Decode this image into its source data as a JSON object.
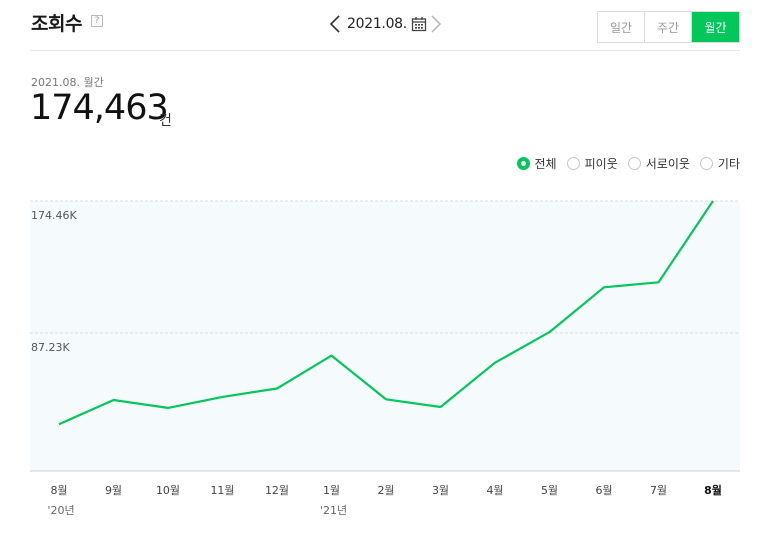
{
  "header": {
    "title": "조회수",
    "help_label": "?",
    "date_label": "2021.08.",
    "tabs": [
      {
        "label": "일간",
        "active": false
      },
      {
        "label": "주간",
        "active": false
      },
      {
        "label": "월간",
        "active": true
      }
    ]
  },
  "summary": {
    "date": "2021.08. 월간",
    "value": "174,463",
    "unit": "건"
  },
  "legend": {
    "items": [
      {
        "label": "전체",
        "checked": true
      },
      {
        "label": "피이웃",
        "checked": false
      },
      {
        "label": "서로이웃",
        "checked": false
      },
      {
        "label": "기타",
        "checked": false
      }
    ]
  },
  "colors": {
    "accent": "#03c75a",
    "plot_bg": "#f5fbfc"
  },
  "chart_data": {
    "type": "line",
    "categories": [
      "8월",
      "9월",
      "10월",
      "11월",
      "12월",
      "1월",
      "2월",
      "3월",
      "4월",
      "5월",
      "6월",
      "7월",
      "8월"
    ],
    "year_labels": [
      {
        "index": 0,
        "label": "'20년"
      },
      {
        "index": 5,
        "label": "'21년"
      }
    ],
    "bold_last_category": true,
    "values": [
      26900,
      42900,
      37700,
      45000,
      50500,
      72300,
      43400,
      38300,
      67600,
      87800,
      117400,
      120700,
      174463
    ],
    "y_ticks": [
      {
        "value": 87230,
        "label": "87.23K"
      },
      {
        "value": 174460,
        "label": "174.46K"
      }
    ],
    "ylim": [
      -4000,
      174460
    ],
    "grid": "dashed horizontal"
  }
}
